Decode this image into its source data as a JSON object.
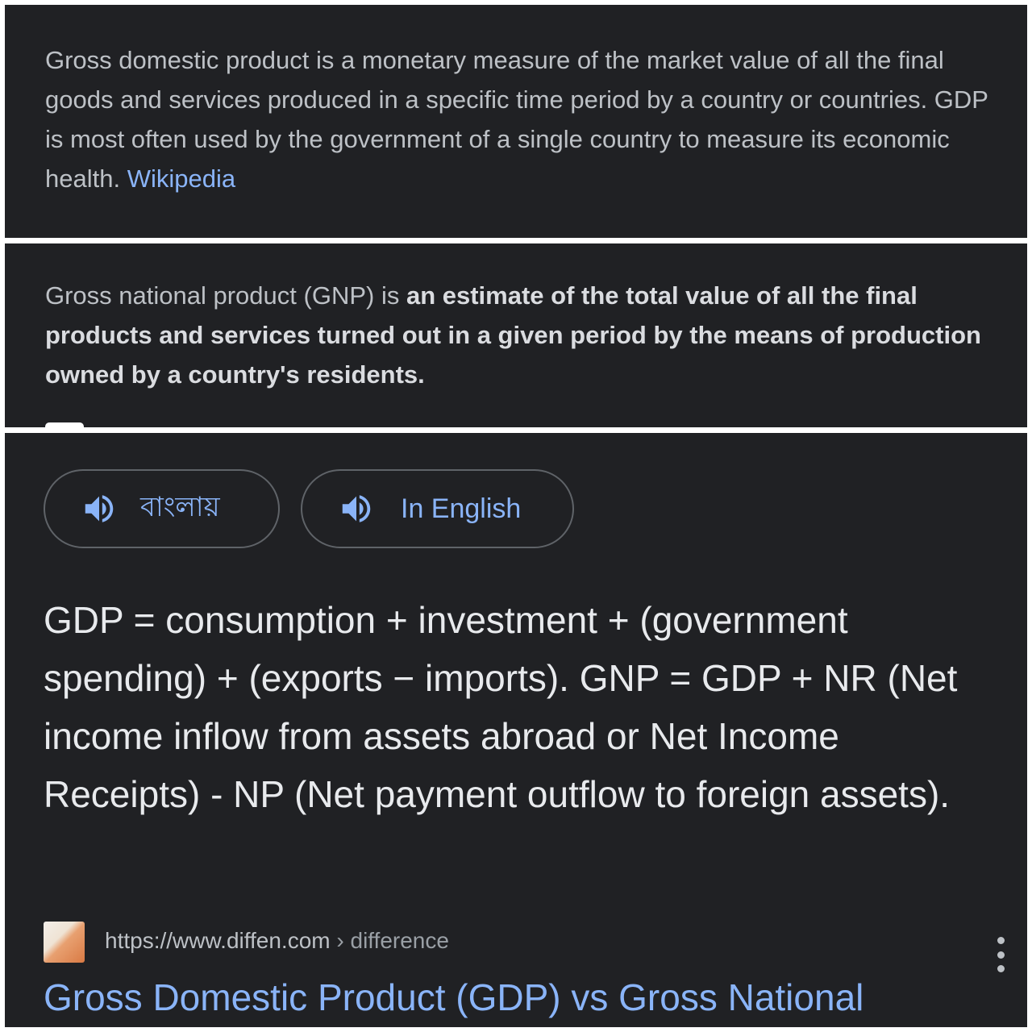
{
  "gdp_snippet": {
    "text": "Gross domestic product is a monetary measure of the market value of all the final goods and services produced in a specific time period by a country or countries. GDP is most often used by the government of a single country to measure its economic health.",
    "source_link": "Wikipedia"
  },
  "gnp_snippet": {
    "prefix": "Gross national product (GNP) is",
    "highlight": "an estimate of the total value of all the final products and services turned out in a given period by the means of production owned by a country's residents."
  },
  "audio_buttons": [
    {
      "label": "বাংলায়",
      "icon": "speaker-icon"
    },
    {
      "label": "In English",
      "icon": "speaker-icon"
    }
  ],
  "answer_text": "GDP = consumption + investment + (government spending) + (exports − imports). GNP = GDP + NR (Net income inflow from assets abroad or Net Income Receipts) - NP (Net payment outflow to foreign assets).",
  "result": {
    "url": "https://www.diffen.com",
    "breadcrumb": "› difference",
    "title": "Gross Domestic Product (GDP) vs Gross National",
    "more_icon": "more-vert-icon"
  },
  "colors": {
    "background": "#202124",
    "link": "#8ab4f8",
    "text": "#bdc1c6",
    "answer_text": "#e8eaed",
    "divider": "#ffffff"
  }
}
